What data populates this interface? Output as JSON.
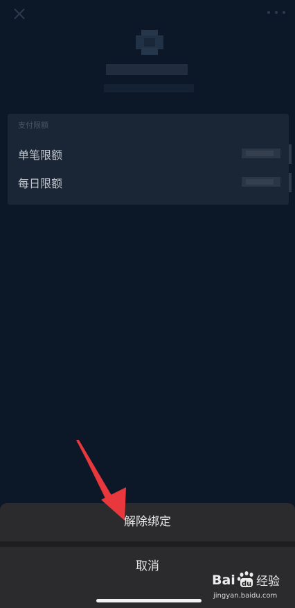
{
  "card": {
    "header": "支付限额",
    "rows": [
      {
        "label": "单笔限额"
      },
      {
        "label": "每日限额"
      }
    ]
  },
  "action_sheet": {
    "unbind_label": "解除绑定",
    "cancel_label": "取消"
  },
  "watermark": {
    "brand": "Bai du 经验",
    "url": "jingyan.baidu.com"
  },
  "colors": {
    "background": "#0c1828",
    "card": "#1a2535",
    "sheet": "#2b2b2d",
    "annotation_arrow": "#e8383d"
  },
  "icons": {
    "close": "close-icon",
    "more": "more-dots-icon"
  }
}
